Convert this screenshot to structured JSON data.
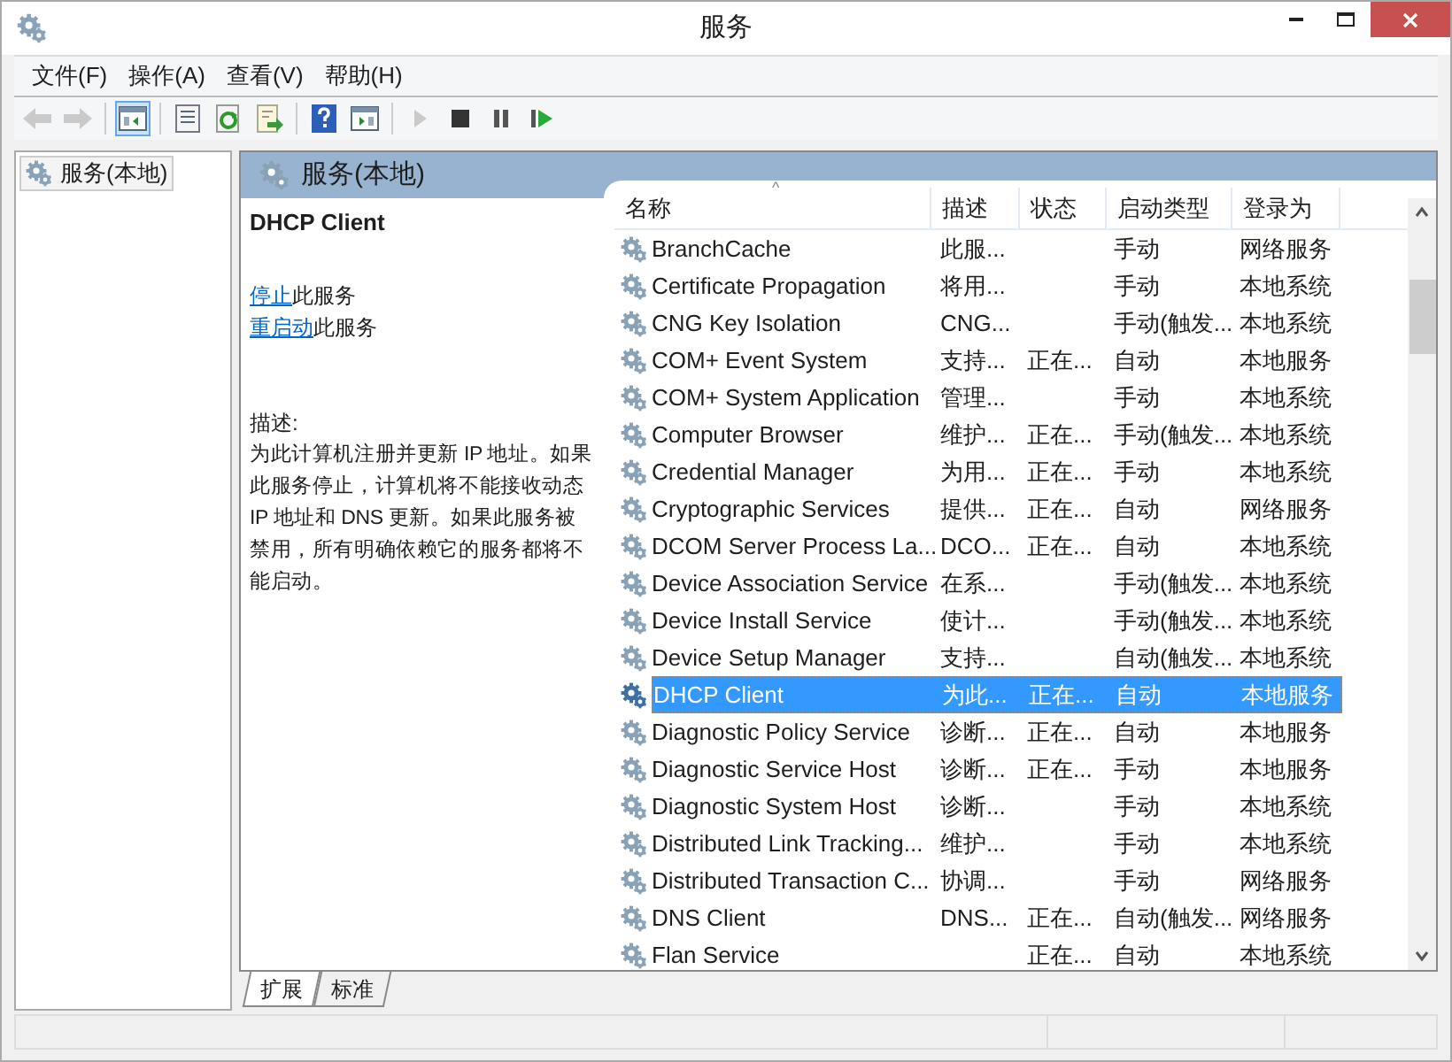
{
  "window": {
    "title": "服务"
  },
  "menu": [
    {
      "label": "文件(F)"
    },
    {
      "label": "操作(A)"
    },
    {
      "label": "查看(V)"
    },
    {
      "label": "帮助(H)"
    }
  ],
  "toolbar": [
    {
      "kind": "back",
      "disabled": true,
      "selected": false
    },
    {
      "kind": "forward",
      "disabled": true,
      "selected": false
    },
    {
      "kind": "tree",
      "disabled": false,
      "selected": true
    },
    {
      "kind": "properties",
      "disabled": false,
      "selected": false
    },
    {
      "kind": "refresh",
      "disabled": false,
      "selected": false
    },
    {
      "kind": "export",
      "disabled": false,
      "selected": false
    },
    {
      "kind": "help",
      "disabled": false,
      "selected": false
    },
    {
      "kind": "view",
      "disabled": false,
      "selected": false
    },
    {
      "kind": "play",
      "disabled": true,
      "selected": false
    },
    {
      "kind": "stop",
      "disabled": false,
      "selected": false
    },
    {
      "kind": "pause",
      "disabled": false,
      "selected": false
    },
    {
      "kind": "resume",
      "disabled": false,
      "selected": false
    }
  ],
  "tree": {
    "items": [
      {
        "label": "服务(本地)",
        "selected": true
      }
    ]
  },
  "panel_title": "服务(本地)",
  "details": {
    "service_name": "DHCP Client",
    "actions": [
      {
        "link": "停止",
        "text": "此服务"
      },
      {
        "link": "重启动",
        "text": "此服务"
      }
    ],
    "description_label": "描述:",
    "description": "为此计算机注册并更新 IP 地址。如果此服务停止，计算机将不能接收动态 IP 地址和 DNS 更新。如果此服务被禁用，所有明确依赖它的服务都将不能启动。"
  },
  "table": {
    "columns": [
      {
        "label": "名称",
        "sorted": true
      },
      {
        "label": "描述",
        "sorted": false
      },
      {
        "label": "状态",
        "sorted": false
      },
      {
        "label": "启动类型",
        "sorted": false
      },
      {
        "label": "登录为",
        "sorted": false
      }
    ],
    "sort_indicator": "^",
    "rows": [
      {
        "name": "BranchCache",
        "description": "此服...",
        "status": "",
        "startup": "手动",
        "logon": "网络服务",
        "selected": false
      },
      {
        "name": "Certificate Propagation",
        "description": "将用...",
        "status": "",
        "startup": "手动",
        "logon": "本地系统",
        "selected": false
      },
      {
        "name": "CNG Key Isolation",
        "description": "CNG...",
        "status": "",
        "startup": "手动(触发...",
        "logon": "本地系统",
        "selected": false
      },
      {
        "name": "COM+ Event System",
        "description": "支持...",
        "status": "正在...",
        "startup": "自动",
        "logon": "本地服务",
        "selected": false
      },
      {
        "name": "COM+ System Application",
        "description": "管理...",
        "status": "",
        "startup": "手动",
        "logon": "本地系统",
        "selected": false
      },
      {
        "name": "Computer Browser",
        "description": "维护...",
        "status": "正在...",
        "startup": "手动(触发...",
        "logon": "本地系统",
        "selected": false
      },
      {
        "name": "Credential Manager",
        "description": "为用...",
        "status": "正在...",
        "startup": "手动",
        "logon": "本地系统",
        "selected": false
      },
      {
        "name": "Cryptographic Services",
        "description": "提供...",
        "status": "正在...",
        "startup": "自动",
        "logon": "网络服务",
        "selected": false
      },
      {
        "name": "DCOM Server Process La...",
        "description": "DCO...",
        "status": "正在...",
        "startup": "自动",
        "logon": "本地系统",
        "selected": false
      },
      {
        "name": "Device Association Service",
        "description": "在系...",
        "status": "",
        "startup": "手动(触发...",
        "logon": "本地系统",
        "selected": false
      },
      {
        "name": "Device Install Service",
        "description": "使计...",
        "status": "",
        "startup": "手动(触发...",
        "logon": "本地系统",
        "selected": false
      },
      {
        "name": "Device Setup Manager",
        "description": "支持...",
        "status": "",
        "startup": "自动(触发...",
        "logon": "本地系统",
        "selected": false
      },
      {
        "name": "DHCP Client",
        "description": "为此...",
        "status": "正在...",
        "startup": "自动",
        "logon": "本地服务",
        "selected": true
      },
      {
        "name": "Diagnostic Policy Service",
        "description": "诊断...",
        "status": "正在...",
        "startup": "自动",
        "logon": "本地服务",
        "selected": false
      },
      {
        "name": "Diagnostic Service Host",
        "description": "诊断...",
        "status": "正在...",
        "startup": "手动",
        "logon": "本地服务",
        "selected": false
      },
      {
        "name": "Diagnostic System Host",
        "description": "诊断...",
        "status": "",
        "startup": "手动",
        "logon": "本地系统",
        "selected": false
      },
      {
        "name": "Distributed Link Tracking...",
        "description": "维护...",
        "status": "",
        "startup": "手动",
        "logon": "本地系统",
        "selected": false
      },
      {
        "name": "Distributed Transaction C...",
        "description": "协调...",
        "status": "",
        "startup": "手动",
        "logon": "网络服务",
        "selected": false
      },
      {
        "name": "DNS Client",
        "description": "DNS...",
        "status": "正在...",
        "startup": "自动(触发...",
        "logon": "网络服务",
        "selected": false
      },
      {
        "name": "Flan Service",
        "description": "",
        "status": "正在...",
        "startup": "自动",
        "logon": "本地系统",
        "selected": false
      }
    ]
  },
  "view_tabs": [
    {
      "label": "扩展",
      "selected": true
    },
    {
      "label": "标准",
      "selected": false
    }
  ]
}
